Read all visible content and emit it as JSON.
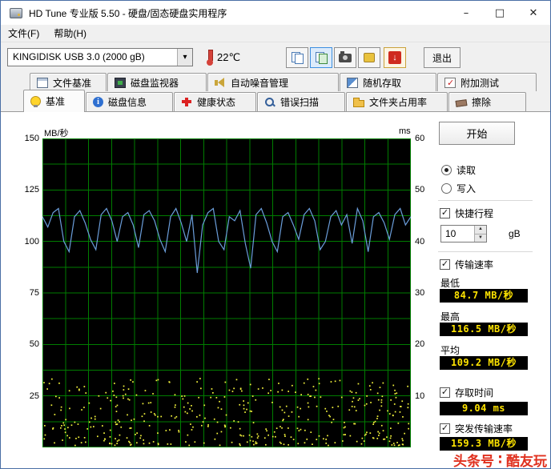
{
  "window": {
    "title": "HD Tune 专业版 5.50 - 硬盘/固态硬盘实用程序",
    "minimize": "–",
    "maximize": "□",
    "close": "✕"
  },
  "menu": {
    "file": "文件(F)",
    "help": "帮助(H)"
  },
  "toolbar": {
    "drive_select": "KINGIDISK USB 3.0 (2000 gB)",
    "temperature": "22℃",
    "exit": "退出",
    "icons": {
      "copy": "copy-icon",
      "copy_image": "copy-image-icon",
      "camera": "camera-icon",
      "export": "export-icon",
      "download": "download-icon"
    }
  },
  "glyphs": {
    "combo_arrow": "▾",
    "down_arrow": "↓",
    "spin_up": "▲",
    "spin_down": "▼",
    "check": "✓"
  },
  "tabs_row1": [
    {
      "label": "文件基准",
      "icon": "file-benchmark-icon"
    },
    {
      "label": "磁盘监视器",
      "icon": "disk-monitor-icon"
    },
    {
      "label": "自动噪音管理",
      "icon": "noise-management-icon"
    },
    {
      "label": "随机存取",
      "icon": "random-access-icon"
    },
    {
      "label": "附加测试",
      "icon": "extra-tests-icon"
    }
  ],
  "tabs_row2": [
    {
      "label": "基准",
      "icon": "benchmark-lamp-icon",
      "active": true
    },
    {
      "label": "磁盘信息",
      "icon": "disk-info-icon"
    },
    {
      "label": "健康状态",
      "icon": "health-icon"
    },
    {
      "label": "错误扫描",
      "icon": "error-scan-icon"
    },
    {
      "label": "文件夹占用率",
      "icon": "folder-usage-icon"
    },
    {
      "label": "擦除",
      "icon": "erase-icon"
    }
  ],
  "panel": {
    "start": "开始",
    "read": "读取",
    "write": "写入",
    "shortstroke_label": "快捷行程",
    "shortstroke_value": "10",
    "shortstroke_unit": "gB",
    "transfer_label": "传输速率",
    "min_label": "最低",
    "min_value": "84.7 MB/秒",
    "max_label": "最高",
    "max_value": "116.5 MB/秒",
    "avg_label": "平均",
    "avg_value": "109.2 MB/秒",
    "access_label": "存取时间",
    "access_value": "9.04 ms",
    "burst_label": "突发传输速率",
    "burst_value": "159.3 MB/秒"
  },
  "chart_data": {
    "type": "line+scatter",
    "left_axis": {
      "label": "MB/秒",
      "ticks": [
        150,
        125,
        100,
        75,
        50,
        25
      ],
      "range": [
        0,
        150
      ]
    },
    "right_axis": {
      "label": "ms",
      "ticks": [
        60,
        50,
        40,
        30,
        20,
        10
      ],
      "range": [
        0,
        60
      ]
    },
    "grid": {
      "v_divisions": 16,
      "h_divisions": 12
    },
    "transfer_rate_series": {
      "name": "传输速率",
      "unit": "MB/秒",
      "values": [
        112,
        107,
        114,
        116,
        100,
        95,
        112,
        115,
        109,
        101,
        96,
        113,
        116,
        110,
        100,
        112,
        114,
        108,
        97,
        113,
        115,
        110,
        101,
        95,
        112,
        116,
        109,
        100,
        113,
        84.7,
        108,
        114,
        116,
        100,
        96,
        112,
        110,
        115,
        99,
        87,
        113,
        116,
        109,
        100,
        95,
        112,
        114,
        108,
        101,
        113,
        116,
        110,
        96,
        100,
        112,
        115,
        108,
        113,
        99,
        116,
        110,
        95,
        112,
        114,
        109,
        101,
        113,
        116,
        108,
        112
      ]
    },
    "access_time_scatter": {
      "name": "存取时间",
      "unit": "ms",
      "count": 430,
      "ms_min": 0.5,
      "ms_max": 13.5,
      "skew": 1.25,
      "seed": 13
    },
    "stats": {
      "min": 84.7,
      "max": 116.5,
      "avg": 109.2,
      "access_ms": 9.04,
      "burst": 159.3
    },
    "colors": {
      "plot_bg": "#000000",
      "grid": "#007d00",
      "line": "#6b9edb",
      "dots": "#f4f43c",
      "value_text": "#ffe400",
      "value_bg": "#000000"
    }
  },
  "watermark": {
    "part1": "头条号",
    "divider": "∶",
    "part2": "酷友玩"
  }
}
